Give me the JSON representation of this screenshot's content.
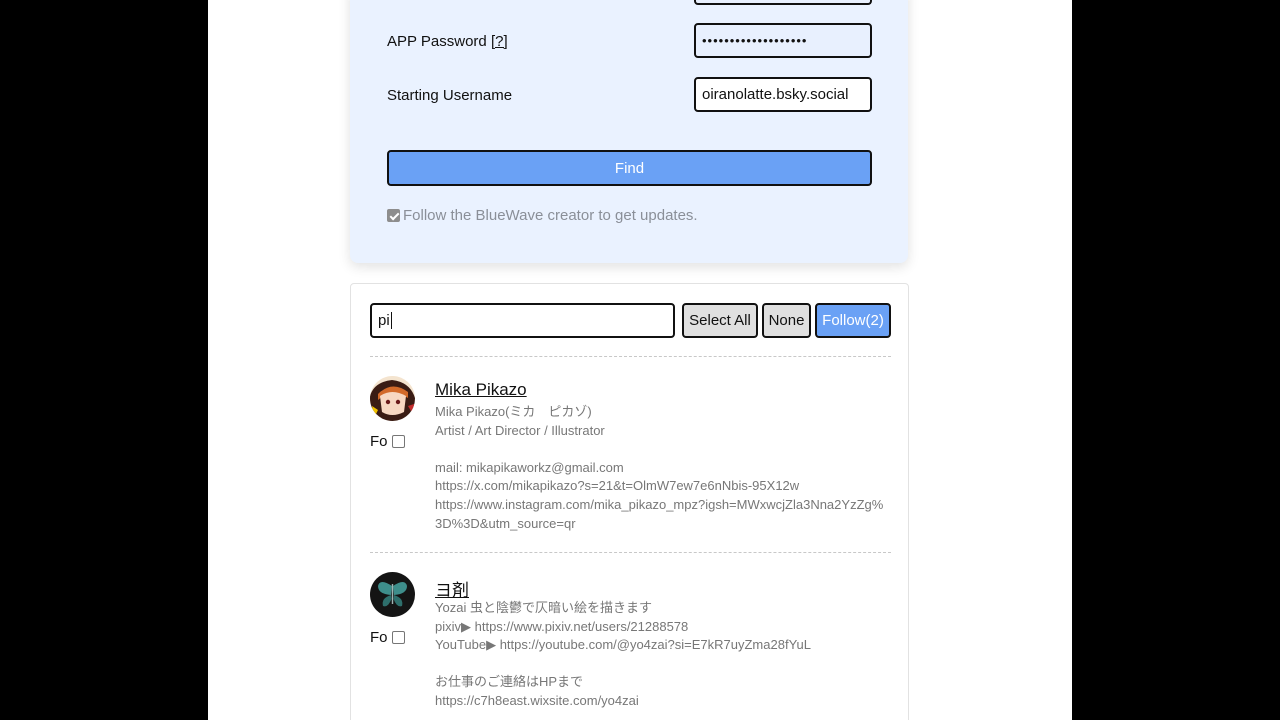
{
  "login": {
    "app_password_label": "APP Password",
    "help_link": "[?]",
    "app_password_value": "•••••••••••••••••••",
    "starting_username_label": "Starting Username",
    "starting_username_value": "oiranolatte.bsky.social",
    "find_button": "Find",
    "follow_creator_label": "Follow the BlueWave creator to get updates.",
    "follow_creator_checked": true
  },
  "results": {
    "filter_value": "pi",
    "select_all_label": "Select All",
    "none_label": "None",
    "follow_label": "Follow(2)",
    "users": [
      {
        "name": "Mika Pikazo",
        "fo_label": "Fo",
        "checked": false,
        "avatar": "avatar-icon",
        "description": "Mika Pikazo(ミカ　ピカゾ)\nArtist / Art Director / Illustrator\n\nmail: mikapikaworkz@gmail.com\nhttps://x.com/mikapikazo?s=21&t=OlmW7ew7e6nNbis-95X12w\nhttps://www.instagram.com/mika_pikazo_mpz?igsh=MWxwcjZla3Nna2YzZg%3D%3D&utm_source=qr"
      },
      {
        "name": "ヨ剤",
        "fo_label": "Fo",
        "checked": false,
        "avatar": "butterfly-icon",
        "description": "Yozai 虫と陰鬱で仄暗い絵を描きます\npixiv▶ https://www.pixiv.net/users/21288578\nYouTube▶ https://youtube.com/@yo4zai?si=E7kR7uyZma28fYuL\n\nお仕事のご連絡はHPまで\nhttps://c7h8east.wixsite.com/yo4zai"
      }
    ]
  }
}
